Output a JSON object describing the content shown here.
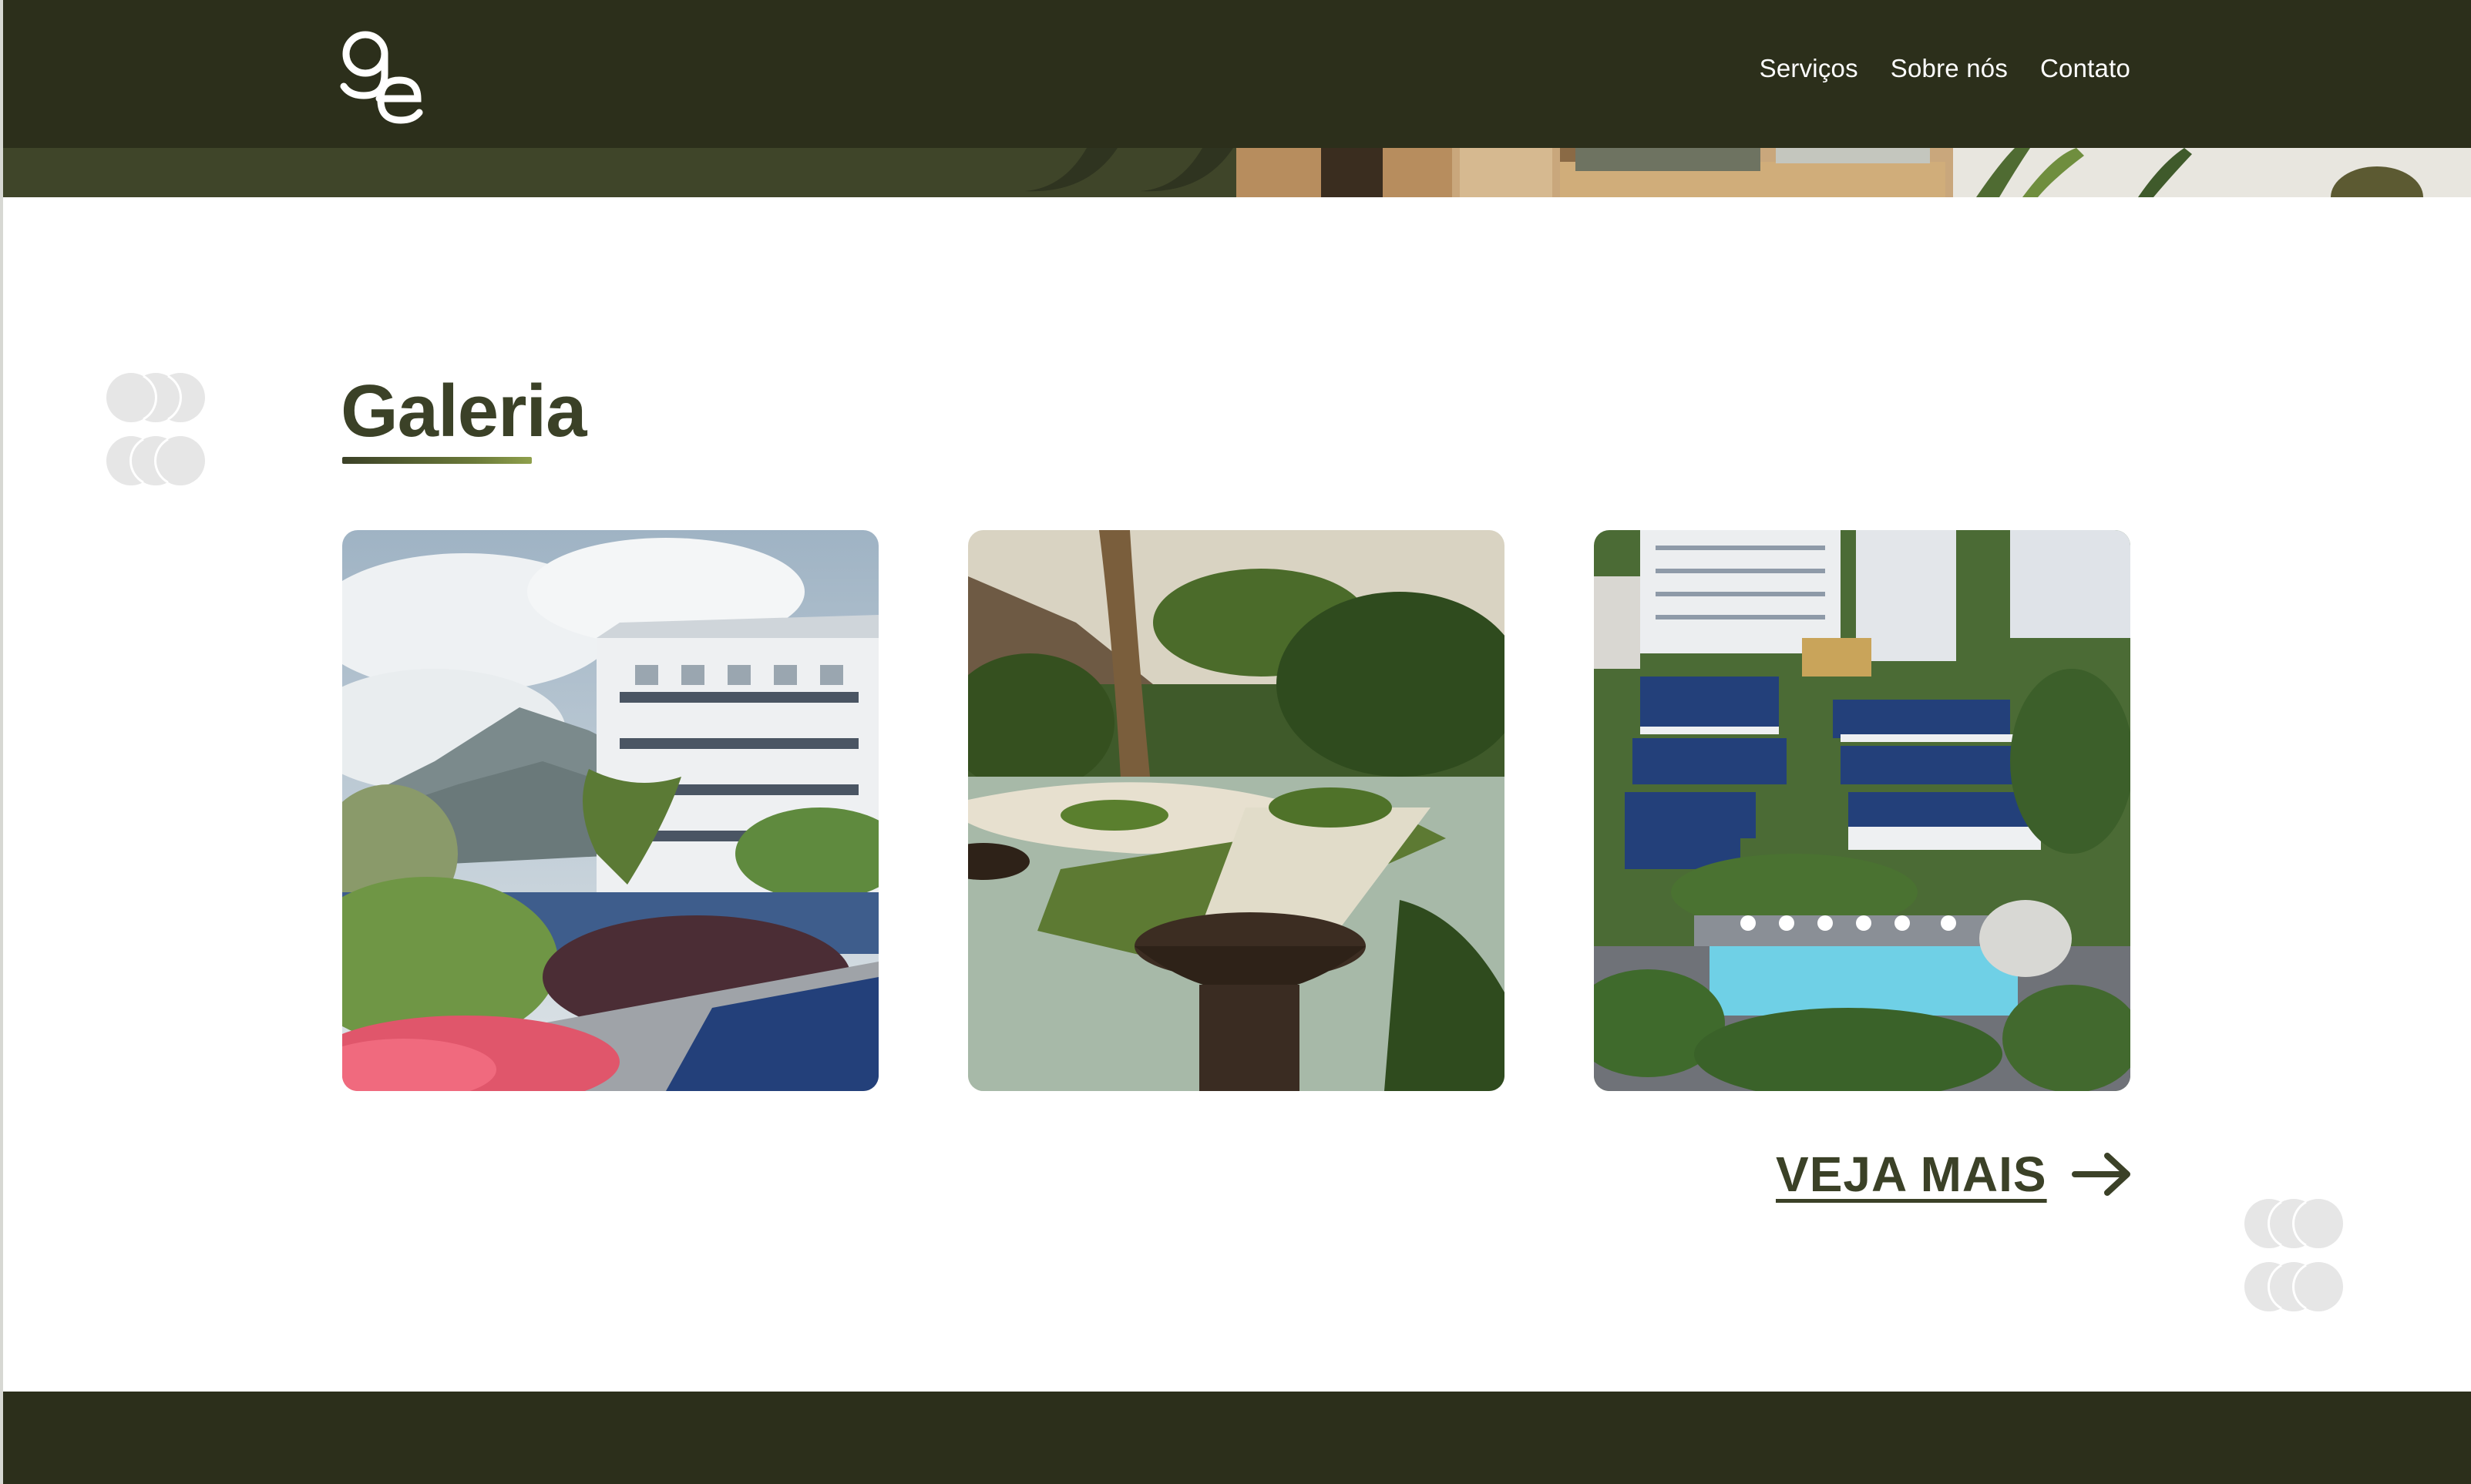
{
  "header": {
    "logo_alt": "gp",
    "nav": [
      {
        "label": "Serviços"
      },
      {
        "label": "Sobre nós"
      },
      {
        "label": "Contato"
      }
    ]
  },
  "gallery": {
    "title": "Galeria",
    "cards": [
      {
        "icon": "hotel-mountain-garden-photo"
      },
      {
        "icon": "resort-fountain-palms-photo"
      },
      {
        "icon": "aerial-resort-pool-photo"
      }
    ],
    "see_more_label": "VEJA MAIS",
    "see_more_icon": "arrow-right-icon"
  },
  "colors": {
    "dark_green": "#2c2f1b",
    "olive": "#3b4127",
    "accent": "#8fa04c",
    "deco_gray": "#e6e6e6"
  }
}
